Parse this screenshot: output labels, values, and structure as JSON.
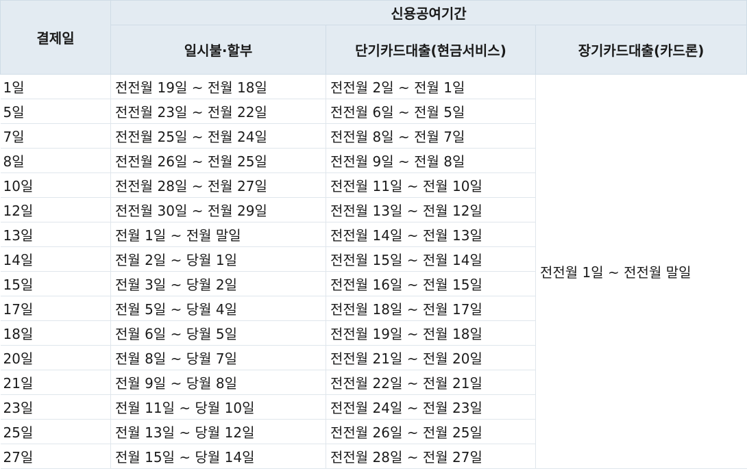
{
  "header": {
    "payment_day": "결제일",
    "credit_period": "신용공여기간",
    "lump_installment": "일시불·할부",
    "short_term_loan": "단기카드대출(현금서비스)",
    "long_term_loan": "장기카드대출(카드론)"
  },
  "long_term_period": "전전월 1일 ~ 전전월 말일",
  "rows": [
    {
      "day": "1일",
      "lump": "전전월 19일 ~ 전월 18일",
      "short": "전전월 2일 ~ 전월 1일"
    },
    {
      "day": "5일",
      "lump": "전전월 23일 ~ 전월 22일",
      "short": "전전월 6일 ~ 전월 5일"
    },
    {
      "day": "7일",
      "lump": "전전월 25일 ~ 전월 24일",
      "short": "전전월 8일 ~ 전월 7일"
    },
    {
      "day": "8일",
      "lump": "전전월 26일 ~ 전월 25일",
      "short": "전전월 9일 ~ 전월 8일"
    },
    {
      "day": "10일",
      "lump": "전전월 28일 ~ 전월 27일",
      "short": "전전월 11일 ~ 전월 10일"
    },
    {
      "day": "12일",
      "lump": "전전월 30일 ~ 전월 29일",
      "short": "전전월 13일 ~ 전월 12일"
    },
    {
      "day": "13일",
      "lump": "전월 1일 ~ 전월 말일",
      "short": "전전월 14일 ~ 전월 13일"
    },
    {
      "day": "14일",
      "lump": "전월 2일 ~ 당월 1일",
      "short": "전전월 15일 ~ 전월 14일"
    },
    {
      "day": "15일",
      "lump": "전월 3일 ~ 당월 2일",
      "short": "전전월 16일 ~ 전월 15일"
    },
    {
      "day": "17일",
      "lump": "전월 5일 ~ 당월 4일",
      "short": "전전월 18일 ~ 전월 17일"
    },
    {
      "day": "18일",
      "lump": "전월 6일 ~ 당월 5일",
      "short": "전전월 19일 ~ 전월 18일"
    },
    {
      "day": "20일",
      "lump": "전월 8일 ~ 당월 7일",
      "short": "전전월 21일 ~ 전월 20일"
    },
    {
      "day": "21일",
      "lump": "전월 9일 ~ 당월 8일",
      "short": "전전월 22일 ~ 전월 21일"
    },
    {
      "day": "23일",
      "lump": "전월 11일 ~ 당월 10일",
      "short": "전전월 24일 ~ 전월 23일"
    },
    {
      "day": "25일",
      "lump": "전월 13일 ~ 당월 12일",
      "short": "전전월 26일 ~ 전월 25일"
    },
    {
      "day": "27일",
      "lump": "전월 15일 ~ 당월 14일",
      "short": "전전월 28일 ~ 전월 27일"
    }
  ]
}
